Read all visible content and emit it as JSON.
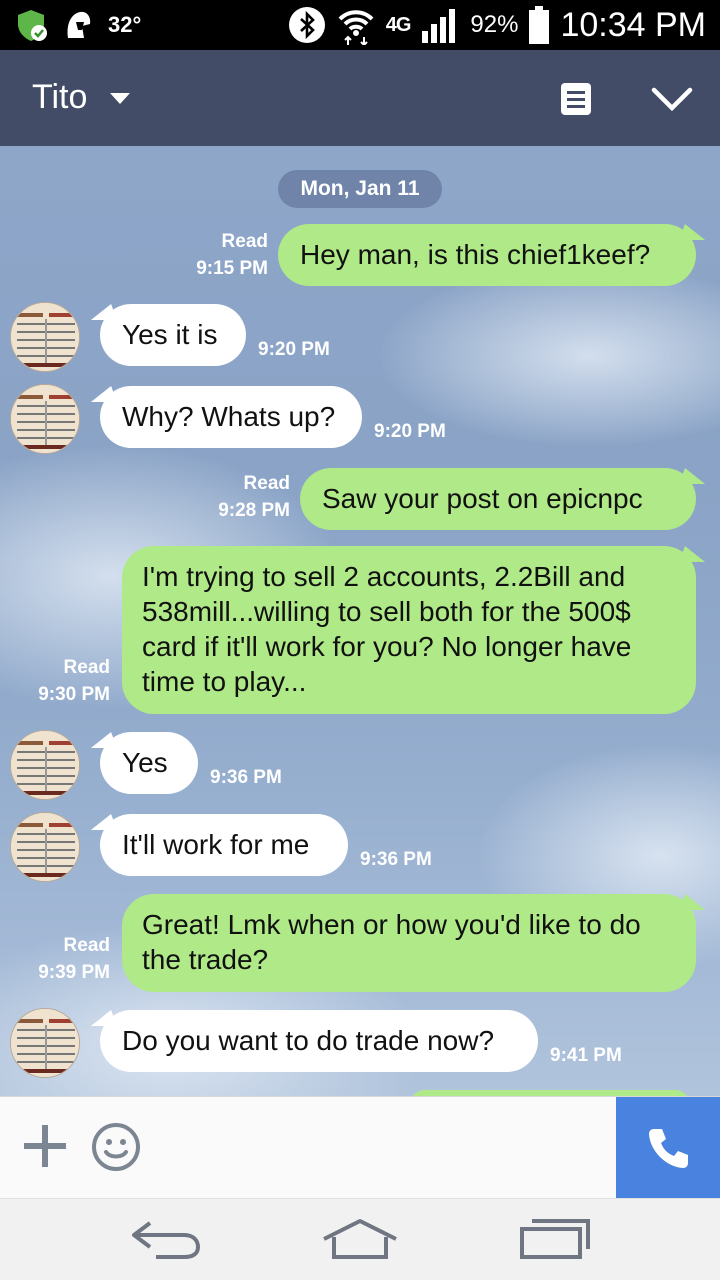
{
  "status_bar": {
    "temperature": "32°",
    "network": "4G",
    "battery_percent": "92%",
    "time": "10:34 PM"
  },
  "header": {
    "contact_name": "Tito"
  },
  "chat": {
    "date": "Mon, Jan 11",
    "messages": [
      {
        "direction": "out",
        "text": "Hey man, is this chief1keef?",
        "status": "Read",
        "time": "9:15 PM"
      },
      {
        "direction": "in",
        "text": "Yes it is",
        "time": "9:20 PM"
      },
      {
        "direction": "in",
        "text": "Why? Whats up?",
        "time": "9:20 PM"
      },
      {
        "direction": "out",
        "text": "Saw your post on epicnpc",
        "status": "Read",
        "time": "9:28 PM"
      },
      {
        "direction": "out",
        "text": "I'm trying to sell 2 accounts, 2.2Bill and 538mill...willing to sell both for the 500$ card if it'll work for you? No longer have time to play...",
        "status": "Read",
        "time": "9:30 PM"
      },
      {
        "direction": "in",
        "text": "Yes",
        "time": "9:36 PM"
      },
      {
        "direction": "in",
        "text": "It'll work for me",
        "time": "9:36 PM"
      },
      {
        "direction": "out",
        "text": "Great! Lmk when or how you'd like to do the trade?",
        "status": "Read",
        "time": "9:39 PM"
      },
      {
        "direction": "in",
        "text": "Do you want to do trade now?",
        "time": "9:41 PM"
      }
    ]
  },
  "colors": {
    "header_bg": "#434c66",
    "outgoing_bubble": "#b0e988",
    "incoming_bubble": "#ffffff",
    "call_button": "#4a82e0"
  }
}
